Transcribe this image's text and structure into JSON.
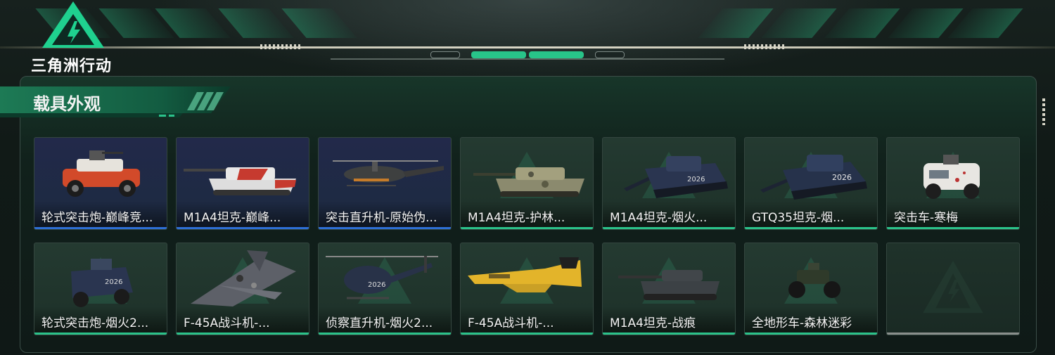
{
  "header": {
    "game_title": "三角洲行动"
  },
  "section": {
    "title": "载具外观"
  },
  "colors": {
    "accent_green": "#2bc28a",
    "accent_blue": "#2e6fd6",
    "panel_bg": "#14231d"
  },
  "cards": [
    {
      "label": "轮式突击炮-巅峰竞...",
      "rarity": "blue",
      "icon": "armored-vehicle-red"
    },
    {
      "label": "M1A4坦克-巅峰...",
      "rarity": "blue",
      "icon": "tank-red-white"
    },
    {
      "label": "突击直升机-原始伪...",
      "rarity": "blue",
      "icon": "attack-helicopter"
    },
    {
      "label": "M1A4坦克-护林...",
      "rarity": "green",
      "icon": "tank-camo"
    },
    {
      "label": "M1A4坦克-烟火...",
      "rarity": "green",
      "icon": "tank-navy"
    },
    {
      "label": "GTQ35坦克-烟...",
      "rarity": "green",
      "icon": "tank-navy-2026"
    },
    {
      "label": "突击车-寒梅",
      "rarity": "green",
      "icon": "assault-vehicle-white"
    },
    {
      "label": "轮式突击炮-烟火2...",
      "rarity": "green",
      "icon": "armored-vehicle-navy"
    },
    {
      "label": "F-45A战斗机-...",
      "rarity": "green",
      "icon": "fighter-jet-camo"
    },
    {
      "label": "侦察直升机-烟火2...",
      "rarity": "green",
      "icon": "scout-helicopter"
    },
    {
      "label": "F-45A战斗机-...",
      "rarity": "green",
      "icon": "fighter-jet-yellow"
    },
    {
      "label": "M1A4坦克-战痕",
      "rarity": "green",
      "icon": "tank-dark"
    },
    {
      "label": "全地形车-森林迷彩",
      "rarity": "green",
      "icon": "atv"
    },
    {
      "label": "",
      "rarity": "empty",
      "icon": "empty-slot"
    }
  ]
}
